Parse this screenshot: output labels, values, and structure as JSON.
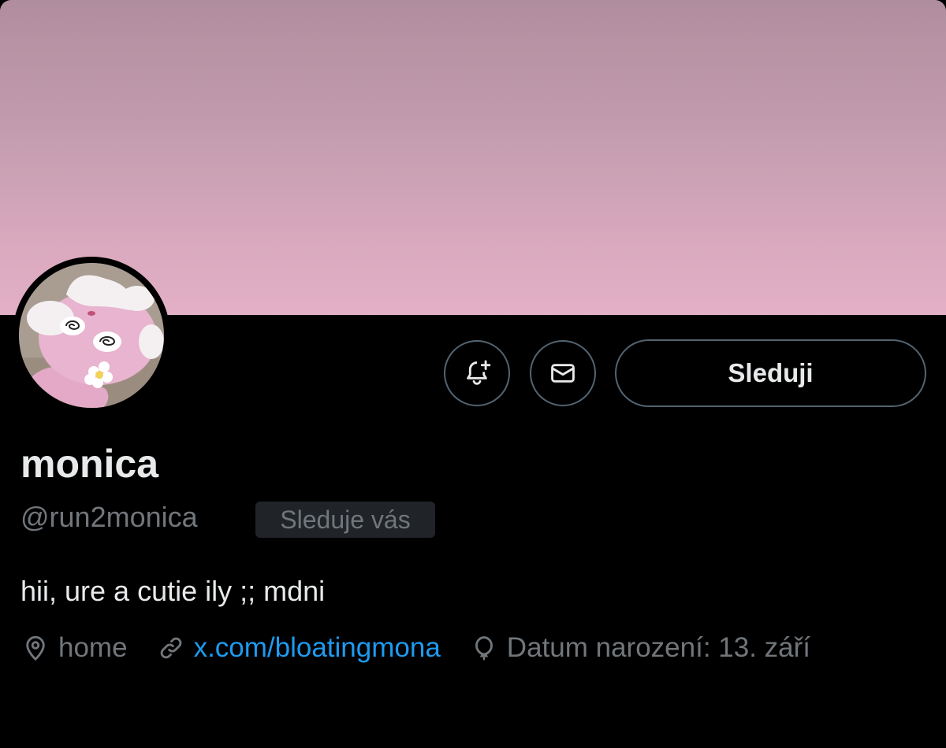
{
  "profile": {
    "display_name": "monica",
    "handle": "@run2monica",
    "follows_you_badge": "Sleduje vás",
    "bio": "hii, ure a cutie ily ;; mdni",
    "location": "home",
    "website": "x.com/bloatingmona",
    "birthday": "Datum narození: 13. září"
  },
  "actions": {
    "follow_label": "Sleduji",
    "notify_icon": "bell-plus-icon",
    "message_icon": "envelope-icon"
  },
  "colors": {
    "background": "#000000",
    "banner_top": "#b08d9e",
    "banner_bottom": "#e3b0c6",
    "text_primary": "#e7e9ea",
    "text_secondary": "#71767b",
    "link": "#1d9bf0",
    "button_border": "#536471"
  }
}
